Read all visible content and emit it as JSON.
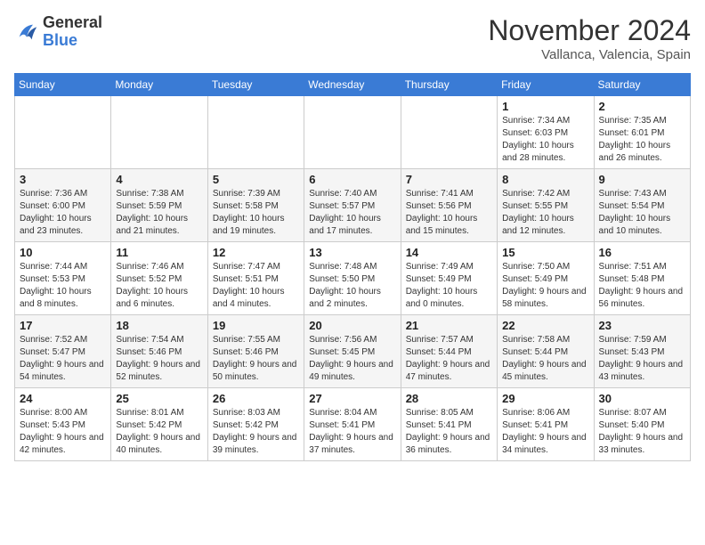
{
  "header": {
    "logo": {
      "line1": "General",
      "line2": "Blue"
    },
    "title": "November 2024",
    "location": "Vallanca, Valencia, Spain"
  },
  "weekdays": [
    "Sunday",
    "Monday",
    "Tuesday",
    "Wednesday",
    "Thursday",
    "Friday",
    "Saturday"
  ],
  "weeks": [
    [
      {
        "day": null,
        "info": null
      },
      {
        "day": null,
        "info": null
      },
      {
        "day": null,
        "info": null
      },
      {
        "day": null,
        "info": null
      },
      {
        "day": null,
        "info": null
      },
      {
        "day": "1",
        "info": "Sunrise: 7:34 AM\nSunset: 6:03 PM\nDaylight: 10 hours and 28 minutes."
      },
      {
        "day": "2",
        "info": "Sunrise: 7:35 AM\nSunset: 6:01 PM\nDaylight: 10 hours and 26 minutes."
      }
    ],
    [
      {
        "day": "3",
        "info": "Sunrise: 7:36 AM\nSunset: 6:00 PM\nDaylight: 10 hours and 23 minutes."
      },
      {
        "day": "4",
        "info": "Sunrise: 7:38 AM\nSunset: 5:59 PM\nDaylight: 10 hours and 21 minutes."
      },
      {
        "day": "5",
        "info": "Sunrise: 7:39 AM\nSunset: 5:58 PM\nDaylight: 10 hours and 19 minutes."
      },
      {
        "day": "6",
        "info": "Sunrise: 7:40 AM\nSunset: 5:57 PM\nDaylight: 10 hours and 17 minutes."
      },
      {
        "day": "7",
        "info": "Sunrise: 7:41 AM\nSunset: 5:56 PM\nDaylight: 10 hours and 15 minutes."
      },
      {
        "day": "8",
        "info": "Sunrise: 7:42 AM\nSunset: 5:55 PM\nDaylight: 10 hours and 12 minutes."
      },
      {
        "day": "9",
        "info": "Sunrise: 7:43 AM\nSunset: 5:54 PM\nDaylight: 10 hours and 10 minutes."
      }
    ],
    [
      {
        "day": "10",
        "info": "Sunrise: 7:44 AM\nSunset: 5:53 PM\nDaylight: 10 hours and 8 minutes."
      },
      {
        "day": "11",
        "info": "Sunrise: 7:46 AM\nSunset: 5:52 PM\nDaylight: 10 hours and 6 minutes."
      },
      {
        "day": "12",
        "info": "Sunrise: 7:47 AM\nSunset: 5:51 PM\nDaylight: 10 hours and 4 minutes."
      },
      {
        "day": "13",
        "info": "Sunrise: 7:48 AM\nSunset: 5:50 PM\nDaylight: 10 hours and 2 minutes."
      },
      {
        "day": "14",
        "info": "Sunrise: 7:49 AM\nSunset: 5:49 PM\nDaylight: 10 hours and 0 minutes."
      },
      {
        "day": "15",
        "info": "Sunrise: 7:50 AM\nSunset: 5:49 PM\nDaylight: 9 hours and 58 minutes."
      },
      {
        "day": "16",
        "info": "Sunrise: 7:51 AM\nSunset: 5:48 PM\nDaylight: 9 hours and 56 minutes."
      }
    ],
    [
      {
        "day": "17",
        "info": "Sunrise: 7:52 AM\nSunset: 5:47 PM\nDaylight: 9 hours and 54 minutes."
      },
      {
        "day": "18",
        "info": "Sunrise: 7:54 AM\nSunset: 5:46 PM\nDaylight: 9 hours and 52 minutes."
      },
      {
        "day": "19",
        "info": "Sunrise: 7:55 AM\nSunset: 5:46 PM\nDaylight: 9 hours and 50 minutes."
      },
      {
        "day": "20",
        "info": "Sunrise: 7:56 AM\nSunset: 5:45 PM\nDaylight: 9 hours and 49 minutes."
      },
      {
        "day": "21",
        "info": "Sunrise: 7:57 AM\nSunset: 5:44 PM\nDaylight: 9 hours and 47 minutes."
      },
      {
        "day": "22",
        "info": "Sunrise: 7:58 AM\nSunset: 5:44 PM\nDaylight: 9 hours and 45 minutes."
      },
      {
        "day": "23",
        "info": "Sunrise: 7:59 AM\nSunset: 5:43 PM\nDaylight: 9 hours and 43 minutes."
      }
    ],
    [
      {
        "day": "24",
        "info": "Sunrise: 8:00 AM\nSunset: 5:43 PM\nDaylight: 9 hours and 42 minutes."
      },
      {
        "day": "25",
        "info": "Sunrise: 8:01 AM\nSunset: 5:42 PM\nDaylight: 9 hours and 40 minutes."
      },
      {
        "day": "26",
        "info": "Sunrise: 8:03 AM\nSunset: 5:42 PM\nDaylight: 9 hours and 39 minutes."
      },
      {
        "day": "27",
        "info": "Sunrise: 8:04 AM\nSunset: 5:41 PM\nDaylight: 9 hours and 37 minutes."
      },
      {
        "day": "28",
        "info": "Sunrise: 8:05 AM\nSunset: 5:41 PM\nDaylight: 9 hours and 36 minutes."
      },
      {
        "day": "29",
        "info": "Sunrise: 8:06 AM\nSunset: 5:41 PM\nDaylight: 9 hours and 34 minutes."
      },
      {
        "day": "30",
        "info": "Sunrise: 8:07 AM\nSunset: 5:40 PM\nDaylight: 9 hours and 33 minutes."
      }
    ]
  ]
}
